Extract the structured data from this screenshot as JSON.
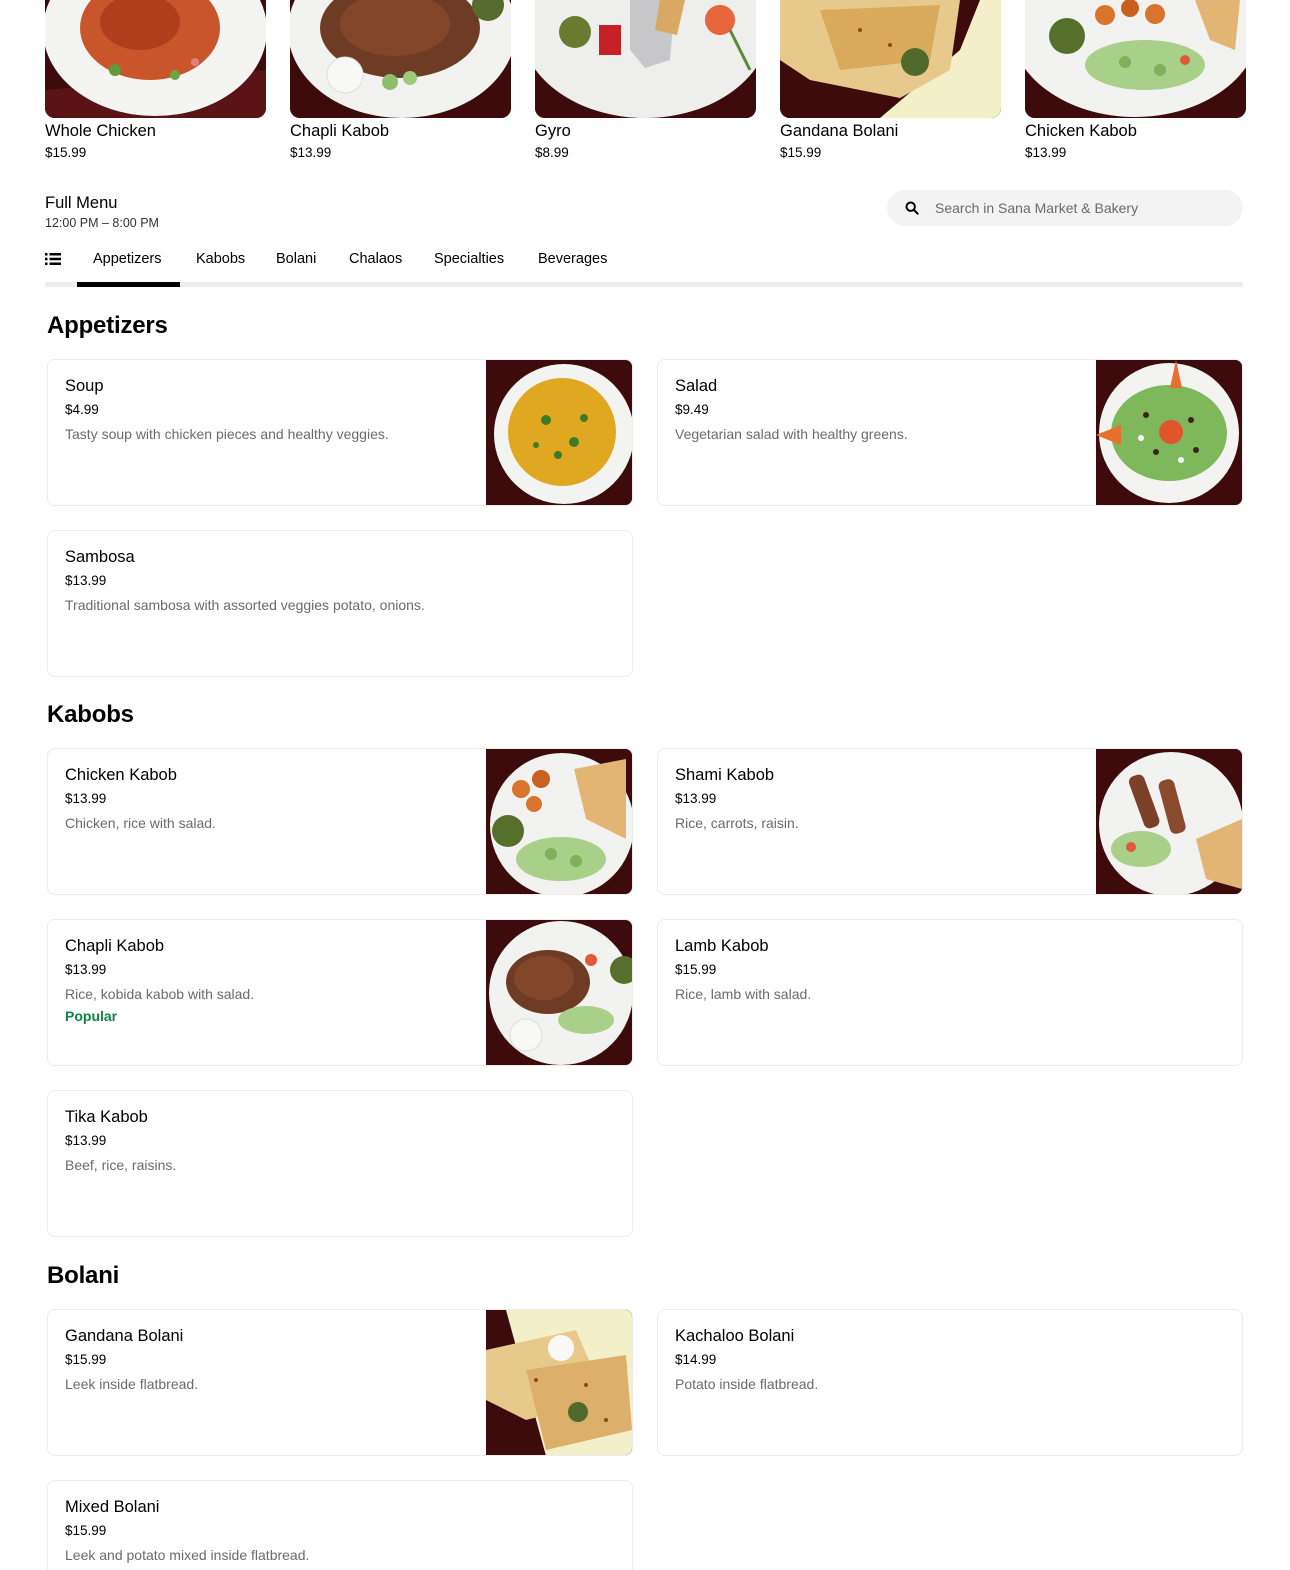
{
  "featured": [
    {
      "name": "Whole Chicken",
      "price": "$15.99"
    },
    {
      "name": "Chapli Kabob",
      "price": "$13.99"
    },
    {
      "name": "Gyro",
      "price": "$8.99"
    },
    {
      "name": "Gandana Bolani",
      "price": "$15.99"
    },
    {
      "name": "Chicken Kabob",
      "price": "$13.99"
    }
  ],
  "menu": {
    "title": "Full Menu",
    "hours": "12:00 PM – 8:00 PM"
  },
  "search": {
    "placeholder": "Search in Sana Market & Bakery"
  },
  "tabs": [
    "Appetizers",
    "Kabobs",
    "Bolani",
    "Chalaos",
    "Specialties",
    "Beverages"
  ],
  "active_tab": "Appetizers",
  "sections": {
    "appetizers": {
      "title": "Appetizers",
      "items": [
        {
          "name": "Soup",
          "price": "$4.99",
          "description": "Tasty soup with chicken pieces and healthy veggies."
        },
        {
          "name": "Salad",
          "price": "$9.49",
          "description": "Vegetarian salad with healthy greens."
        },
        {
          "name": "Sambosa",
          "price": "$13.99",
          "description": "Traditional sambosa with assorted veggies potato, onions."
        }
      ]
    },
    "kabobs": {
      "title": "Kabobs",
      "items": [
        {
          "name": "Chicken Kabob",
          "price": "$13.99",
          "description": "Chicken, rice with salad."
        },
        {
          "name": "Shami Kabob",
          "price": "$13.99",
          "description": "Rice, carrots, raisin."
        },
        {
          "name": "Chapli Kabob",
          "price": "$13.99",
          "description": "Rice, kobida kabob with salad.",
          "tag": "Popular"
        },
        {
          "name": "Lamb Kabob",
          "price": "$15.99",
          "description": "Rice, lamb with salad."
        },
        {
          "name": "Tika Kabob",
          "price": "$13.99",
          "description": "Beef, rice, raisins."
        }
      ]
    },
    "bolani": {
      "title": "Bolani",
      "items": [
        {
          "name": "Gandana Bolani",
          "price": "$15.99",
          "description": "Leek inside flatbread."
        },
        {
          "name": "Kachaloo Bolani",
          "price": "$14.99",
          "description": "Potato inside flatbread."
        },
        {
          "name": "Mixed Bolani",
          "price": "$15.99",
          "description": "Leek and potato mixed inside flatbread."
        }
      ]
    }
  },
  "colors": {
    "popular_tag": "#0e8345",
    "tab_indicator": "#000000",
    "search_bg": "#f3f3f3",
    "description_text": "#6b6b6b"
  },
  "icons": {
    "search": "search-icon",
    "category_list": "list-icon"
  }
}
